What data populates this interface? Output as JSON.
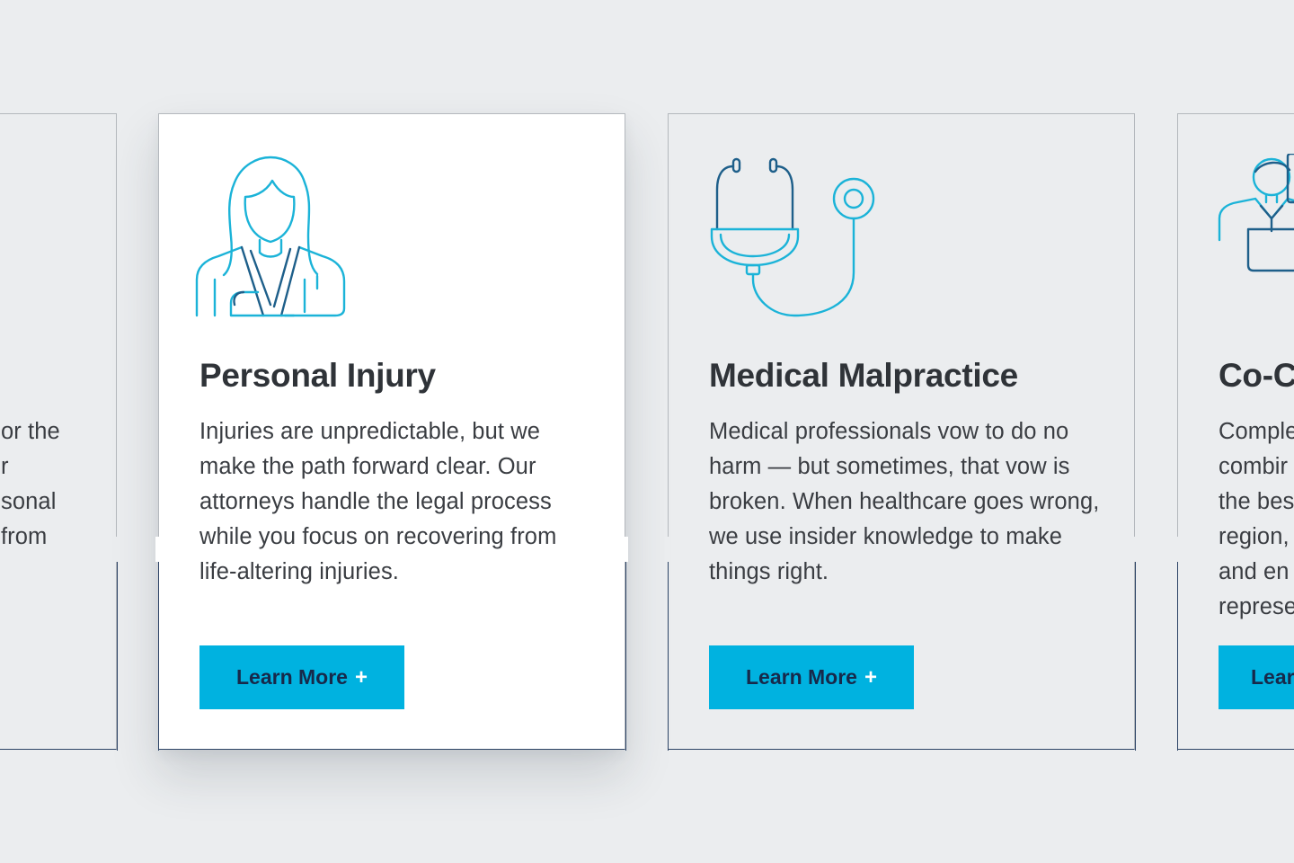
{
  "cards": [
    {
      "id": "partial-left",
      "title": "",
      "text_lines": [
        "or the",
        "r",
        "sonal",
        "from"
      ],
      "button_label": "",
      "icon": "none"
    },
    {
      "id": "personal-injury",
      "title": "Personal Injury",
      "text": "Injuries are unpredictable, but we make the path forward clear. Our attorneys handle the legal process while you focus on recovering from life-altering injuries.",
      "button_label": "Learn More",
      "button_icon": "plus-icon",
      "icon": "injured-person-icon",
      "active": true
    },
    {
      "id": "medical-malpractice",
      "title": "Medical Malpractice",
      "text": "Medical professionals vow to do no harm — but sometimes, that vow is broken. When healthcare goes wrong, we use insider knowledge to make things right.",
      "button_label": "Learn More",
      "button_icon": "plus-icon",
      "icon": "stethoscope-icon"
    },
    {
      "id": "co-counsel",
      "title": "Co-C",
      "text_lines": [
        "Comple",
        "combir",
        "the bes",
        "region,",
        "and en",
        "represe"
      ],
      "button_label": "Lear",
      "icon": "co-counsel-people-icon"
    }
  ],
  "plus_glyph": "+",
  "colors": {
    "background": "#ebedef",
    "accent": "#00b2e0",
    "button_text": "#17294a",
    "icon_light": "#1bb3d8",
    "icon_dark": "#1e5f8a",
    "border_navy": "#2d4466",
    "heading": "#2f3338"
  }
}
